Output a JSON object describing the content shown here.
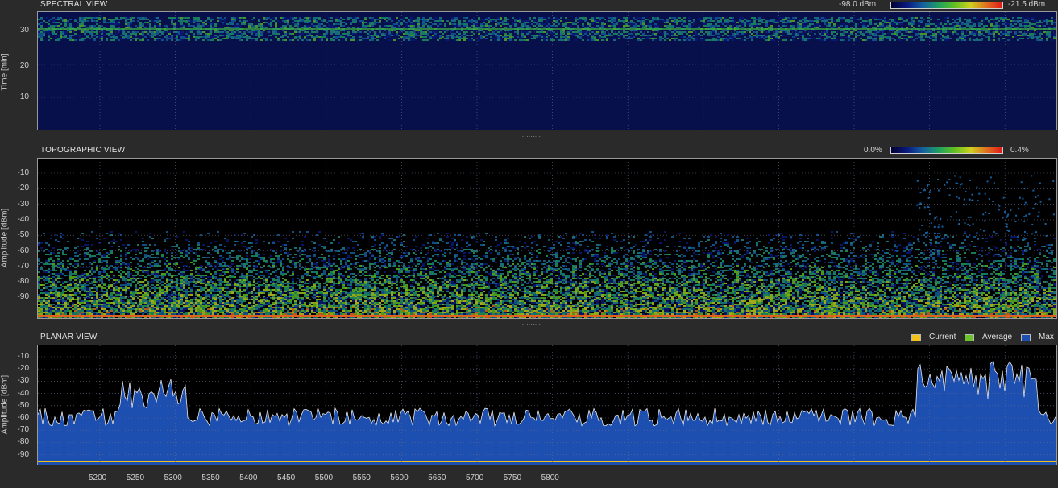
{
  "spectral": {
    "title": "SPECTRAL VIEW",
    "ylabel": "Time [min]",
    "yticks": [
      "30",
      "20",
      "10"
    ],
    "cb_min": "-98.0 dBm",
    "cb_max": "-21.5 dBm"
  },
  "topographic": {
    "title": "TOPOGRAPHIC VIEW",
    "ylabel": "Amplitude [dBm]",
    "yticks": [
      "-10",
      "-20",
      "-30",
      "-40",
      "-50",
      "-60",
      "-70",
      "-80",
      "-90"
    ],
    "cb_min": "0.0%",
    "cb_max": "0.4%"
  },
  "planar": {
    "title": "PLANAR VIEW",
    "ylabel": "Amplitude [dBm]",
    "yticks": [
      "-10",
      "-20",
      "-30",
      "-40",
      "-50",
      "-60",
      "-70",
      "-80",
      "-90"
    ],
    "legend": [
      {
        "label": "Current",
        "color": "#f2c21a"
      },
      {
        "label": "Average",
        "color": "#6bc22a"
      },
      {
        "label": "Max",
        "color": "#1c4fb0"
      }
    ]
  },
  "xaxis": {
    "ticks": [
      "5200",
      "5250",
      "5300",
      "5350",
      "5400",
      "5450",
      "5500",
      "5550",
      "5600",
      "5650",
      "5700",
      "5750",
      "5800"
    ]
  },
  "colors": {
    "spectral_bg": "#07104a",
    "plot_bg": "#000000",
    "max_fill": "#1c4fb0",
    "max_line": "#e8e8e8"
  }
}
